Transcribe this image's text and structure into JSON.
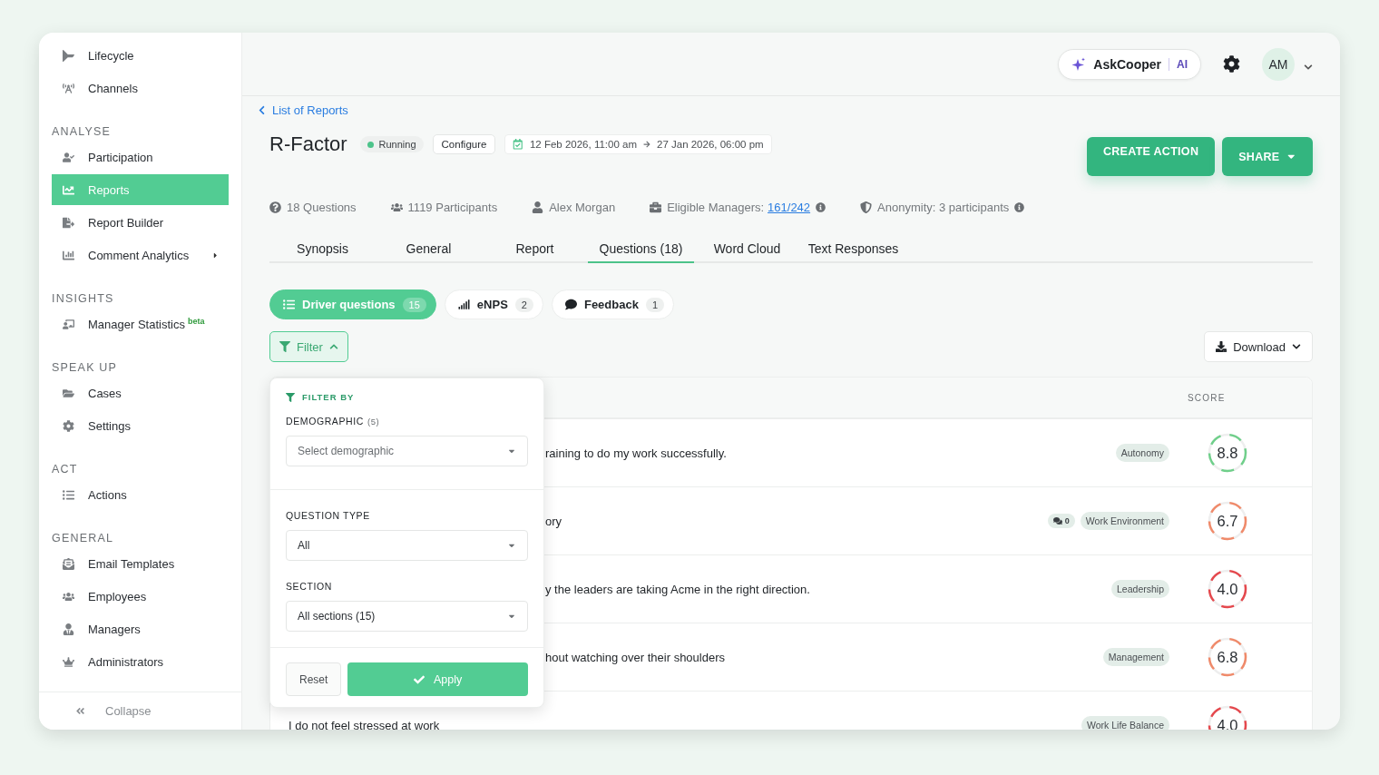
{
  "sidebar": {
    "sections": [
      {
        "items": [
          {
            "label": "Lifecycle",
            "selected": false
          },
          {
            "label": "Channels",
            "selected": false
          }
        ]
      },
      {
        "heading": "ANALYSE",
        "items": [
          {
            "label": "Participation",
            "selected": false
          },
          {
            "label": "Reports",
            "selected": true
          },
          {
            "label": "Report Builder",
            "selected": false
          },
          {
            "label": "Comment Analytics",
            "selected": false,
            "submenu": true
          }
        ]
      },
      {
        "heading": "INSIGHTS",
        "items": [
          {
            "label": "Manager Statistics",
            "badge": "beta",
            "selected": false
          }
        ]
      },
      {
        "heading": "SPEAK UP",
        "items": [
          {
            "label": "Cases",
            "selected": false
          },
          {
            "label": "Settings",
            "selected": false
          }
        ]
      },
      {
        "heading": "ACT",
        "items": [
          {
            "label": "Actions",
            "selected": false
          }
        ]
      },
      {
        "heading": "GENERAL",
        "items": [
          {
            "label": "Email Templates",
            "selected": false
          },
          {
            "label": "Employees",
            "selected": false
          },
          {
            "label": "Managers",
            "selected": false
          },
          {
            "label": "Administrators",
            "selected": false
          }
        ]
      }
    ],
    "collapse": "Collapse"
  },
  "topbar": {
    "assistant": "AskCooper",
    "assistant_tag": "AI",
    "avatar": "AM"
  },
  "breadcrumb": "List of Reports",
  "report": {
    "title": "R-Factor",
    "status": "Running",
    "configure": "Configure",
    "start": "12 Feb 2026, 11:00 am",
    "end": "27 Jan 2026, 06:00 pm"
  },
  "actions": {
    "create": "CREATE ACTION",
    "share": "SHARE"
  },
  "meta": [
    {
      "text": "18 Questions"
    },
    {
      "text": "1119 Participants"
    },
    {
      "text": "Alex Morgan"
    },
    {
      "text": "Eligible Managers:",
      "link": "161/242",
      "info": true
    },
    {
      "text": "Anonymity: 3 participants",
      "info": true
    }
  ],
  "tabs": [
    {
      "label": "Synopsis",
      "selected": false
    },
    {
      "label": "General",
      "selected": false
    },
    {
      "label": "Report",
      "selected": false
    },
    {
      "label": "Questions (18)",
      "selected": true
    },
    {
      "label": "Word Cloud",
      "selected": false
    },
    {
      "label": "Text Responses",
      "selected": false
    }
  ],
  "question_groups": [
    {
      "label": "Driver questions",
      "count": "15",
      "selected": true
    },
    {
      "label": "eNPS",
      "count": "2",
      "selected": false
    },
    {
      "label": "Feedback",
      "count": "1",
      "selected": false
    }
  ],
  "filter_button": {
    "label": "Filter",
    "expanded": true
  },
  "download": "Download",
  "filter_panel": {
    "title": "FILTER BY",
    "fields": [
      {
        "label": "DEMOGRAPHIC",
        "count": "(5)",
        "placeholder": "Select demographic"
      },
      {
        "label": "QUESTION TYPE",
        "value": "All"
      },
      {
        "label": "SECTION",
        "value": "All sections (15)"
      }
    ],
    "reset": "Reset",
    "apply": "Apply"
  },
  "table": {
    "score_header": "SCORE",
    "rows": [
      {
        "question": "raining to do my work successfully.",
        "covered": true,
        "tag": "Autonomy",
        "score": "8.8",
        "color": "#6fcf8a"
      },
      {
        "question": "ory",
        "covered": true,
        "comments": "0",
        "tag": "Work Environment",
        "score": "6.7",
        "color": "#f08a6a"
      },
      {
        "question": "y the leaders are taking Acme in the right direction.",
        "covered": true,
        "tag": "Leadership",
        "score": "4.0",
        "color": "#e5484d"
      },
      {
        "question": "hout watching over their shoulders",
        "covered": true,
        "tag": "Management",
        "score": "6.8",
        "color": "#f08a6a"
      },
      {
        "question": "I do not feel stressed at work",
        "tag": "Work Life Balance",
        "score": "4.0",
        "color": "#e5484d"
      }
    ]
  }
}
